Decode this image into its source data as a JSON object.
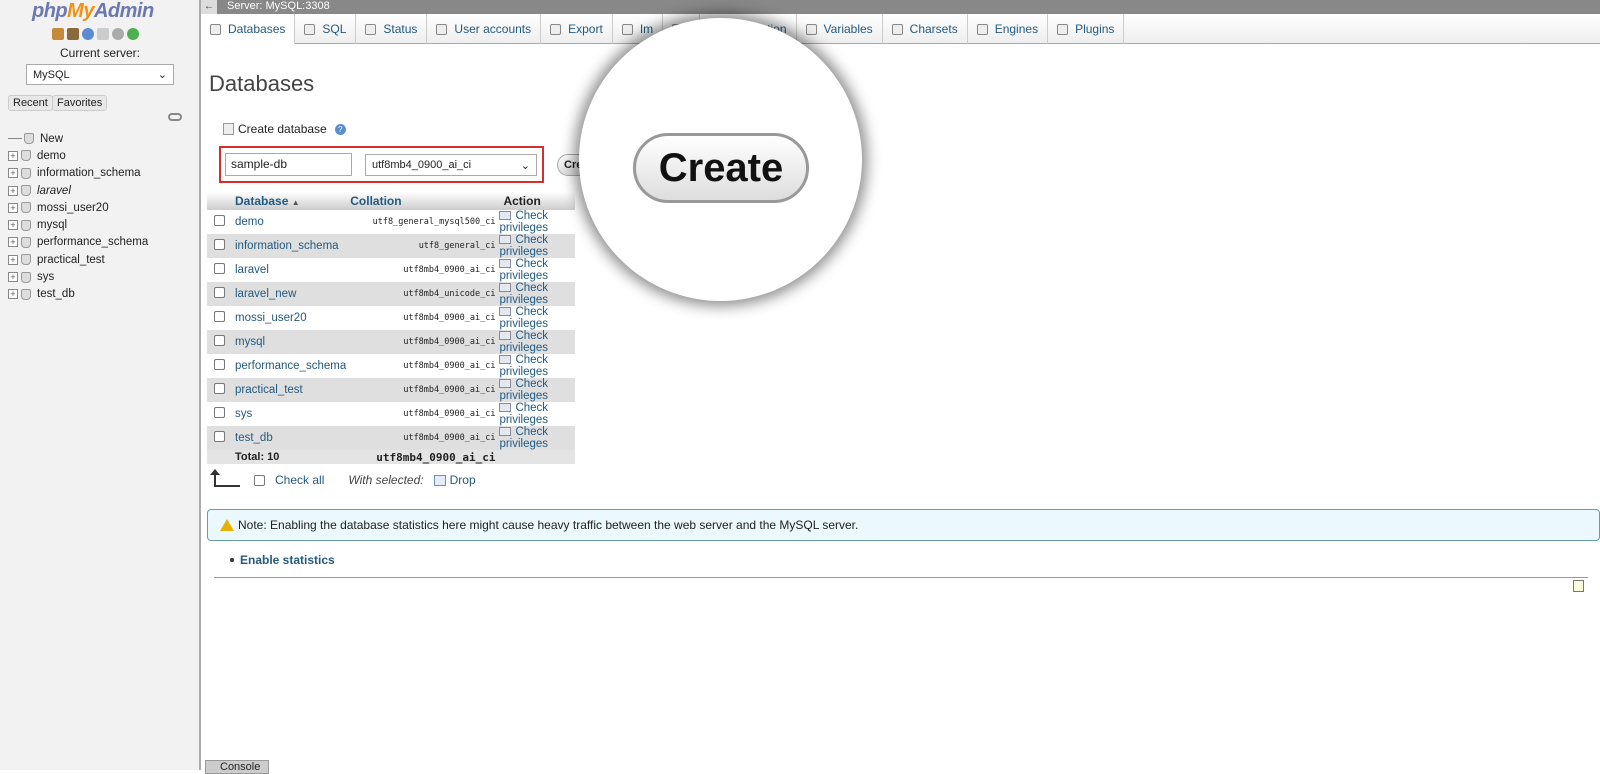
{
  "sidebar": {
    "logo": {
      "php": "php",
      "my": "My",
      "admin": "Admin"
    },
    "current_server_label": "Current server:",
    "server_value": "MySQL",
    "recent": "Recent",
    "favorites": "Favorites",
    "tree": [
      {
        "label": "New",
        "type": "new"
      },
      {
        "label": "demo"
      },
      {
        "label": "information_schema"
      },
      {
        "label": "laravel",
        "italic": true
      },
      {
        "label": "mossi_user20"
      },
      {
        "label": "mysql"
      },
      {
        "label": "performance_schema"
      },
      {
        "label": "practical_test"
      },
      {
        "label": "sys"
      },
      {
        "label": "test_db"
      }
    ]
  },
  "topbar": {
    "server": "Server: MySQL:3308"
  },
  "tabs": [
    "Databases",
    "SQL",
    "Status",
    "User accounts",
    "Export",
    "Im",
    "",
    "Replication",
    "Variables",
    "Charsets",
    "Engines",
    "Plugins"
  ],
  "main": {
    "title": "Databases",
    "create_label": "Create database",
    "db_name_value": "sample-db",
    "collation_value": "utf8mb4_0900_ai_ci",
    "create_button_partial": "Cre",
    "zoom_create": "Create"
  },
  "table": {
    "headers": {
      "database": "Database",
      "collation": "Collation",
      "action": "Action"
    },
    "rows": [
      {
        "name": "demo",
        "collation": "utf8_general_mysql500_ci",
        "action": "Check privileges"
      },
      {
        "name": "information_schema",
        "collation": "utf8_general_ci",
        "action": "Check privileges"
      },
      {
        "name": "laravel",
        "collation": "utf8mb4_0900_ai_ci",
        "action": "Check privileges"
      },
      {
        "name": "laravel_new",
        "collation": "utf8mb4_unicode_ci",
        "action": "Check privileges"
      },
      {
        "name": "mossi_user20",
        "collation": "utf8mb4_0900_ai_ci",
        "action": "Check privileges"
      },
      {
        "name": "mysql",
        "collation": "utf8mb4_0900_ai_ci",
        "action": "Check privileges"
      },
      {
        "name": "performance_schema",
        "collation": "utf8mb4_0900_ai_ci",
        "action": "Check privileges"
      },
      {
        "name": "practical_test",
        "collation": "utf8mb4_0900_ai_ci",
        "action": "Check privileges"
      },
      {
        "name": "sys",
        "collation": "utf8mb4_0900_ai_ci",
        "action": "Check privileges"
      },
      {
        "name": "test_db",
        "collation": "utf8mb4_0900_ai_ci",
        "action": "Check privileges"
      }
    ],
    "total_label": "Total: 10",
    "total_collation": "utf8mb4_0900_ai_ci"
  },
  "bulk": {
    "check_all": "Check all",
    "with_selected": "With selected:",
    "drop": "Drop"
  },
  "note": "Note: Enabling the database statistics here might cause heavy traffic between the web server and the MySQL server.",
  "enable_stats": "Enable statistics",
  "console": "Console"
}
